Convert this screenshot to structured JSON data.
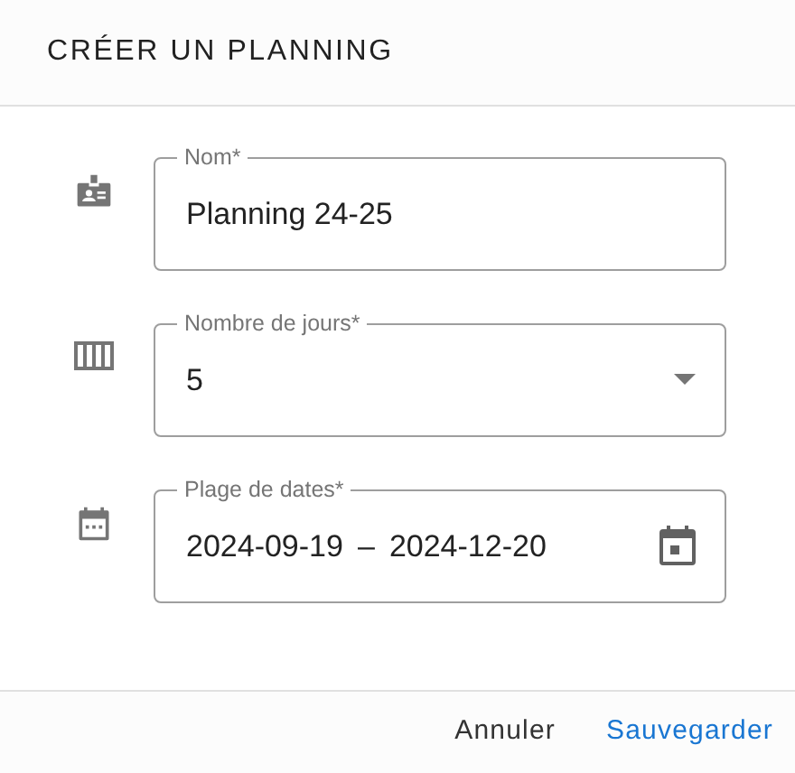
{
  "dialog": {
    "title": "CRÉER UN PLANNING",
    "fields": [
      {
        "kind": "text",
        "label": "Nom*",
        "value": "Planning 24-25"
      },
      {
        "kind": "select",
        "label": "Nombre de jours*",
        "value": "5"
      },
      {
        "kind": "daterange",
        "label": "Plage de dates*",
        "start": "2024-09-19",
        "separator": "–",
        "end": "2024-12-20"
      }
    ],
    "buttons": [
      {
        "label": "Annuler",
        "kind": "cancel"
      },
      {
        "label": "Sauvegarder",
        "kind": "primary"
      }
    ]
  }
}
